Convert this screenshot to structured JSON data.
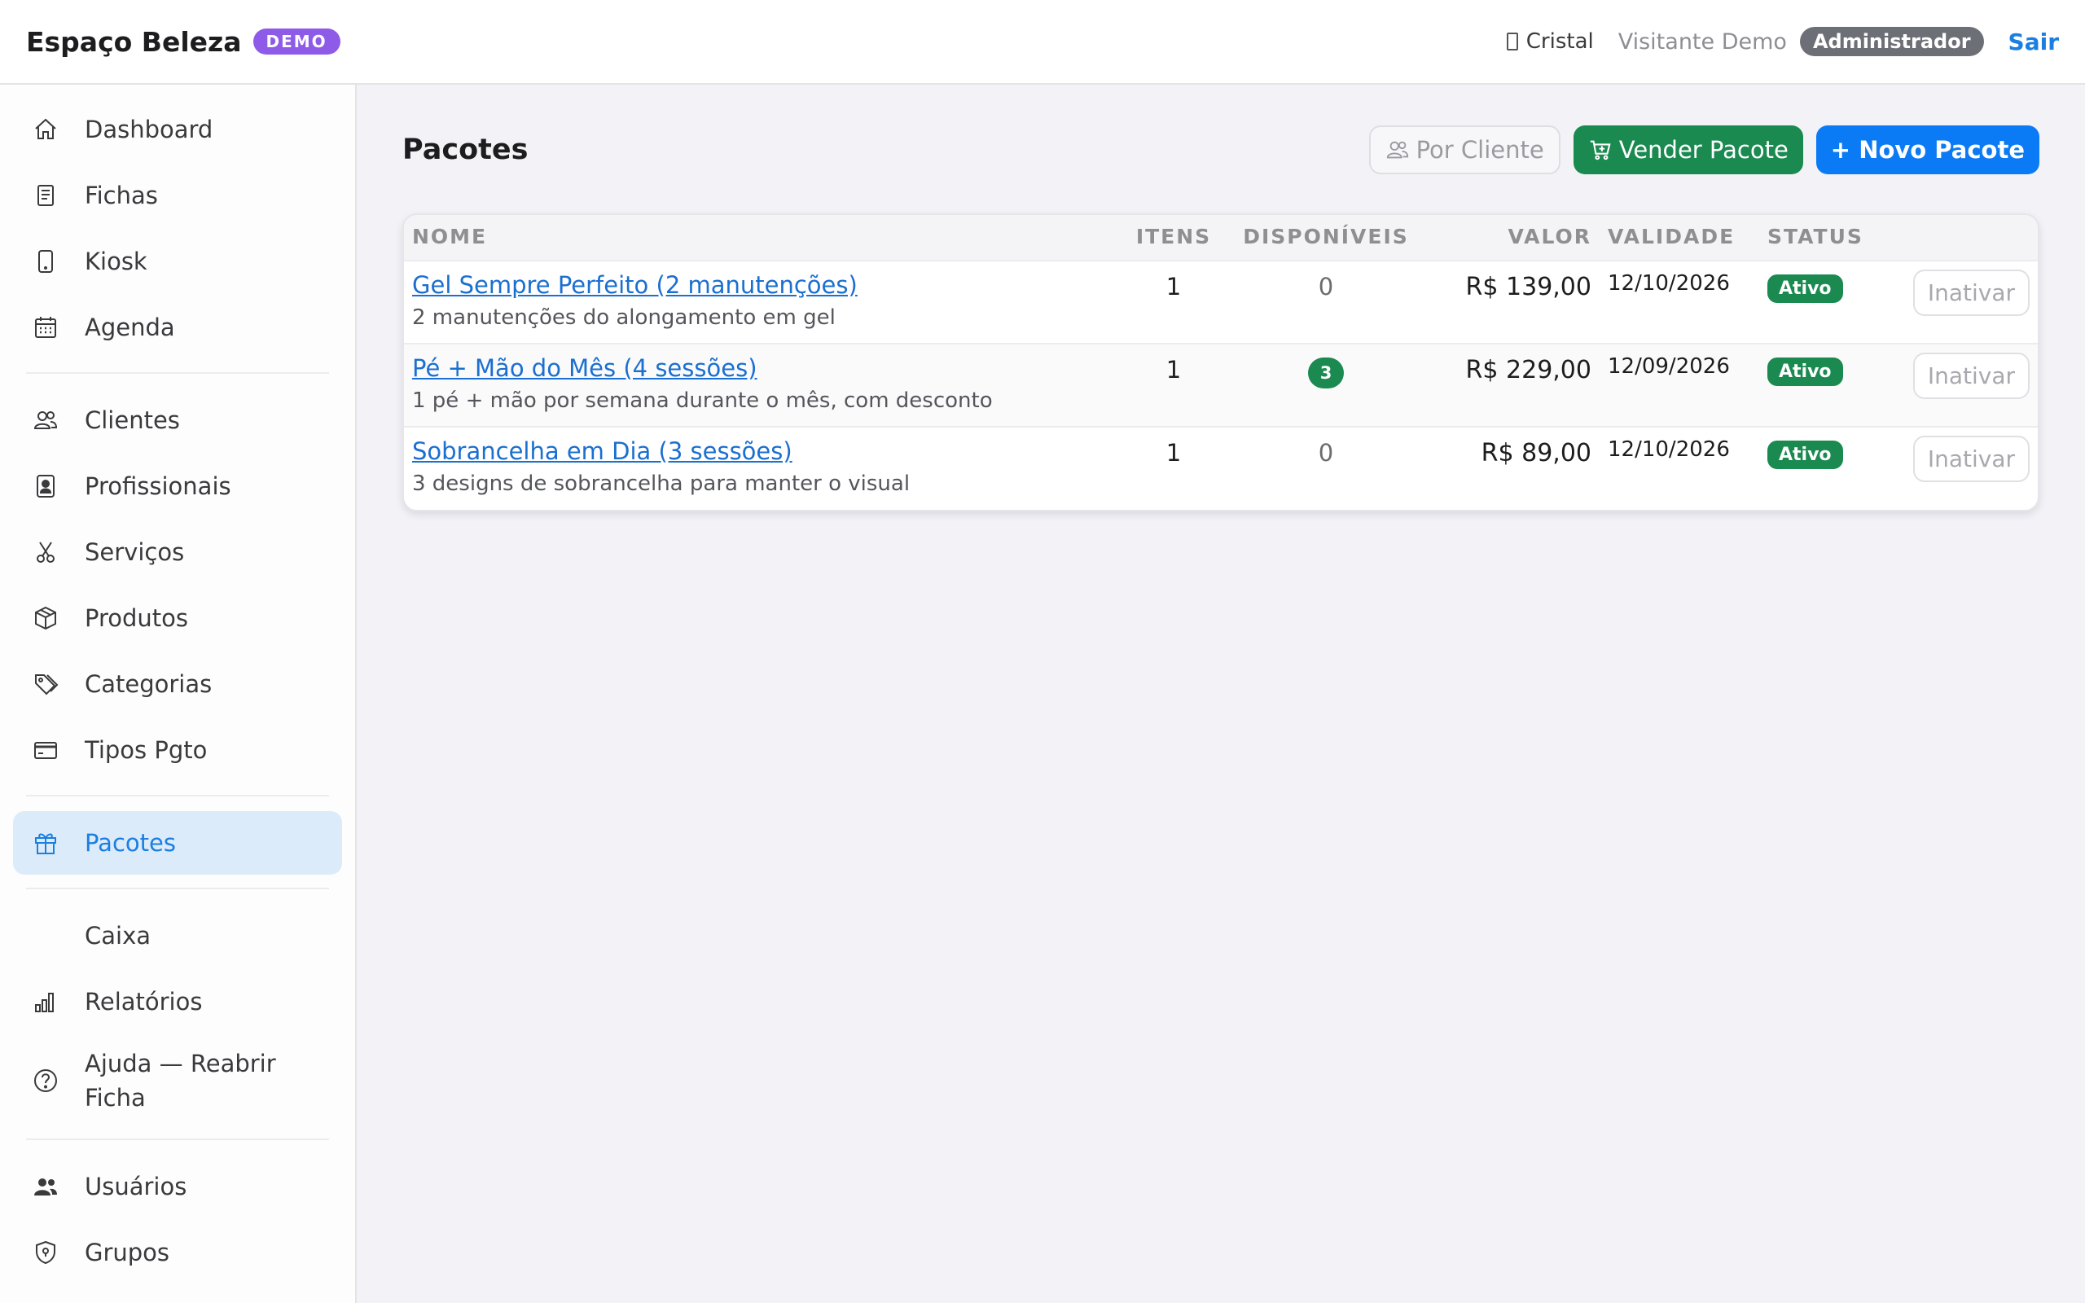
{
  "header": {
    "brand": "Espaço Beleza",
    "demo_badge": "DEMO",
    "tenant_icon_glyph": "",
    "tenant": "Cristal",
    "visitor": "Visitante Demo",
    "role": "Administrador",
    "logout": "Sair"
  },
  "sidebar": {
    "items": [
      {
        "label": "Dashboard",
        "icon": "home-icon"
      },
      {
        "label": "Fichas",
        "icon": "document-icon"
      },
      {
        "label": "Kiosk",
        "icon": "tablet-icon"
      },
      {
        "label": "Agenda",
        "icon": "calendar-icon"
      },
      {
        "label": "Clientes",
        "icon": "people-icon"
      },
      {
        "label": "Profissionais",
        "icon": "badge-icon"
      },
      {
        "label": "Serviços",
        "icon": "scissors-icon"
      },
      {
        "label": "Produtos",
        "icon": "box-icon"
      },
      {
        "label": "Categorias",
        "icon": "tags-icon"
      },
      {
        "label": "Tipos Pgto",
        "icon": "credit-card-icon"
      },
      {
        "label": "Pacotes",
        "icon": "gift-icon",
        "active": true
      },
      {
        "label": "Caixa",
        "icon": ""
      },
      {
        "label": "Relatórios",
        "icon": "bar-chart-icon"
      },
      {
        "label": "Ajuda — Reabrir Ficha",
        "icon": "question-circle-icon"
      },
      {
        "label": "Usuários",
        "icon": "users-icon"
      },
      {
        "label": "Grupos",
        "icon": "shield-icon"
      }
    ]
  },
  "main": {
    "title": "Pacotes",
    "actions": {
      "by_client": "Por Cliente",
      "sell": "Vender Pacote",
      "new": "+ Novo Pacote"
    },
    "table": {
      "columns": [
        "NOME",
        "ITENS",
        "DISPONÍVEIS",
        "VALOR",
        "VALIDADE",
        "STATUS",
        ""
      ],
      "rows": [
        {
          "name": "Gel Sempre Perfeito (2 manutenções)",
          "description": "2 manutenções do alongamento em gel",
          "items": "1",
          "available": "0",
          "value": "R$ 139,00",
          "validity": "12/10/2026",
          "status": "Ativo",
          "action": "Inativar"
        },
        {
          "name": "Pé + Mão do Mês (4 sessões)",
          "description": "1 pé + mão por semana durante o mês, com desconto",
          "items": "1",
          "available": "3",
          "value": "R$ 229,00",
          "validity": "12/09/2026",
          "status": "Ativo",
          "action": "Inativar"
        },
        {
          "name": "Sobrancelha em Dia (3 sessões)",
          "description": "3 designs de sobrancelha para manter o visual",
          "items": "1",
          "available": "0",
          "value": "R$ 89,00",
          "validity": "12/10/2026",
          "status": "Ativo",
          "action": "Inativar"
        }
      ]
    }
  },
  "colors": {
    "accent_blue": "#0a7bf5",
    "success_green": "#1a8a50",
    "demo_purple": "#8e5be8",
    "active_nav_bg": "#dcebfa"
  }
}
